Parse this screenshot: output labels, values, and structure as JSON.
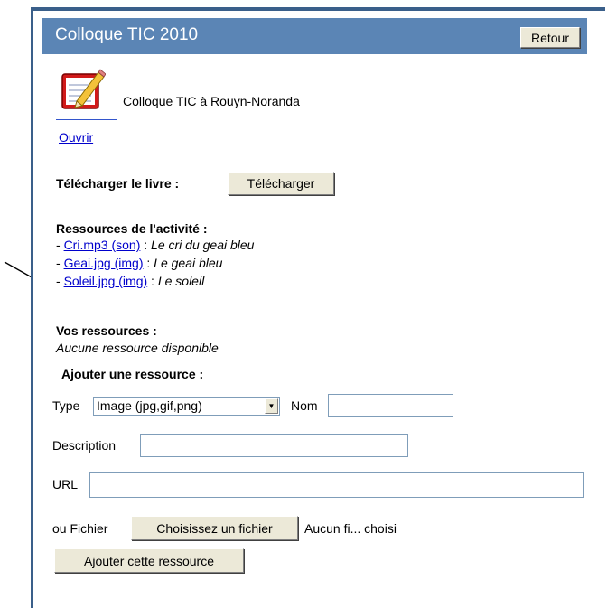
{
  "header": {
    "title": "Colloque TIC 2010",
    "back_label": "Retour"
  },
  "book": {
    "name": "Colloque TIC à Rouyn-Noranda",
    "open_label": "Ouvrir"
  },
  "download": {
    "label": "Télécharger le livre :",
    "button": "Télécharger"
  },
  "activity_resources": {
    "heading": "Ressources de l'activité :",
    "items": [
      {
        "bullet": "- ",
        "link": "Cri.mp3 (son)",
        "sep": " : ",
        "desc": "Le cri du geai bleu"
      },
      {
        "bullet": "- ",
        "link": "Geai.jpg (img)",
        "sep": " : ",
        "desc": "Le geai bleu"
      },
      {
        "bullet": "- ",
        "link": "Soleil.jpg (img)",
        "sep": " : ",
        "desc": "Le soleil"
      }
    ]
  },
  "your_resources": {
    "heading": "Vos ressources :",
    "empty": "Aucune ressource disponible"
  },
  "add_form": {
    "heading": "Ajouter une ressource :",
    "type_label": "Type",
    "type_value": "Image (jpg,gif,png)",
    "name_label": "Nom",
    "description_label": "Description",
    "url_label": "URL",
    "file_label": "ou Fichier",
    "file_button": "Choisissez un fichier",
    "file_status": "Aucun fi... choisi",
    "submit_button": "Ajouter cette ressource"
  },
  "colors": {
    "header_bg": "#5b85b5",
    "border": "#3a5f8a",
    "link": "#0000cc"
  },
  "icons": {
    "book_icon": "notepad-pencil-icon",
    "dropdown": "chevron-down-icon"
  }
}
